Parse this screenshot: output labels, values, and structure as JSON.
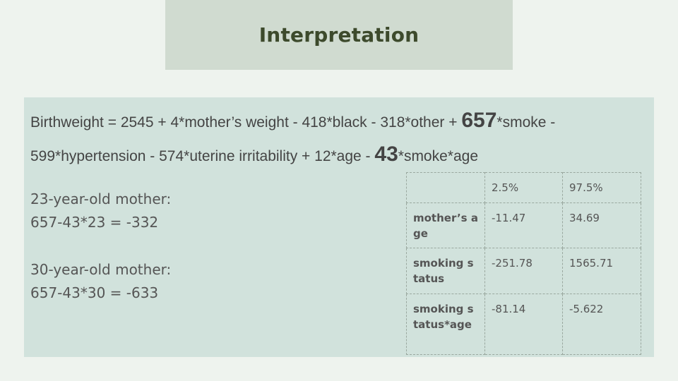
{
  "title": "Interpretation",
  "formula": {
    "line1_a": "Birthweight = 2545 + 4*mother’s weight - 418*black - 318*other + ",
    "line1_big": "657",
    "line1_b": "*smoke - ",
    "line2_a": "599*hypertension - 574*uterine irritability + 12*age - ",
    "line2_big": "43",
    "line2_b": "*smoke*age"
  },
  "examples": [
    {
      "label": "23-year-old mother:",
      "calc": "657-43*23 = -332"
    },
    {
      "label": "30-year-old mother:",
      "calc": "657-43*30 = -633"
    }
  ],
  "ci_table": {
    "headers": [
      "",
      "2.5%",
      "97.5%"
    ],
    "rows": [
      {
        "name": "mother’s age",
        "low": "-11.47",
        "high": "34.69"
      },
      {
        "name": "smoking status",
        "low": "-251.78",
        "high": "1565.71"
      },
      {
        "name": "smoking status*age",
        "low": "-81.14",
        "high": "-5.622"
      }
    ]
  }
}
